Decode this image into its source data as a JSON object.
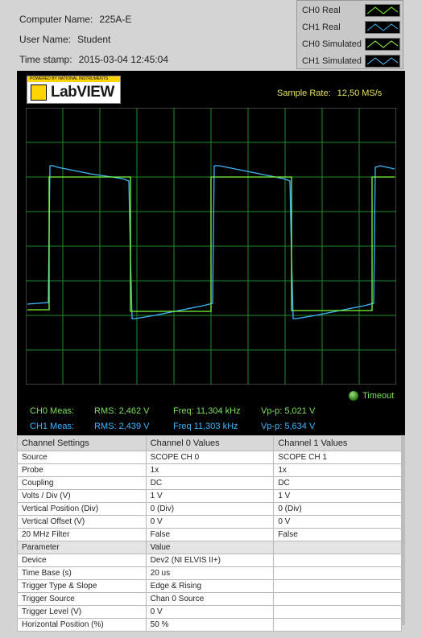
{
  "info": {
    "computer_name_label": "Computer Name:",
    "computer_name": "225A-E",
    "user_name_label": "User Name:",
    "user_name": "Student",
    "timestamp_label": "Time stamp:",
    "timestamp": "2015-03-04 12:45:04"
  },
  "legend": [
    {
      "label": "CH0 Real",
      "color": "#7cff3a"
    },
    {
      "label": "CH1 Real",
      "color": "#3fb8ff"
    },
    {
      "label": "CH0 Simulated",
      "color": "#a0ff5a"
    },
    {
      "label": "CH1 Simulated",
      "color": "#5ac8ff"
    }
  ],
  "scope": {
    "logo_small": "POWERED BY NATIONAL INSTRUMENTS",
    "logo_text": "LabVIEW",
    "sample_rate_label": "Sample Rate:",
    "sample_rate_value": "12,50 MS/s",
    "timeout_label": "Timeout"
  },
  "chart_data": {
    "type": "line",
    "grid": true,
    "divisions_x": 10,
    "divisions_y": 8,
    "series": [
      {
        "name": "CH0 Real",
        "color": "#7cff3a"
      },
      {
        "name": "CH1 Real",
        "color": "#3fb8ff"
      }
    ]
  },
  "measurements": {
    "ch0": {
      "label": "CH0 Meas:",
      "rms_label": "RMS:",
      "rms": "2,462 V",
      "freq_label": "Freq:",
      "freq": "11,304 kHz",
      "vpp_label": "Vp-p:",
      "vpp": "5,021 V"
    },
    "ch1": {
      "label": "CH1 Meas:",
      "rms_label": "RMS:",
      "rms": "2,439 V",
      "freq_label": "Freq",
      "freq": "11,303 kHz",
      "vpp_label": "Vp-p:",
      "vpp": "5,634 V"
    }
  },
  "table": {
    "headers": [
      "Channel Settings",
      "Channel 0 Values",
      "Channel 1 Values"
    ],
    "channel_rows": [
      [
        "Source",
        "SCOPE CH 0",
        "SCOPE CH 1"
      ],
      [
        "Probe",
        "1x",
        "1x"
      ],
      [
        "Coupling",
        "DC",
        "DC"
      ],
      [
        "Volts / Div (V)",
        "1 V",
        "1 V"
      ],
      [
        "Vertical Position (Div)",
        "0 (Div)",
        "0 (Div)"
      ],
      [
        "Vertical Offset (V)",
        "0 V",
        "0 V"
      ],
      [
        "20 MHz Filter",
        "False",
        "False"
      ]
    ],
    "param_header": [
      "Parameter",
      "Value",
      ""
    ],
    "param_rows": [
      [
        "Device",
        "Dev2 (NI ELVIS II+)",
        ""
      ],
      [
        "Time Base (s)",
        "20 us",
        ""
      ],
      [
        "Trigger Type & Slope",
        "Edge & Rising",
        ""
      ],
      [
        "Trigger Source",
        "Chan 0 Source",
        ""
      ],
      [
        "Trigger Level (V)",
        "0 V",
        ""
      ],
      [
        "Horizontal Position (%)",
        "50 %",
        ""
      ]
    ]
  }
}
